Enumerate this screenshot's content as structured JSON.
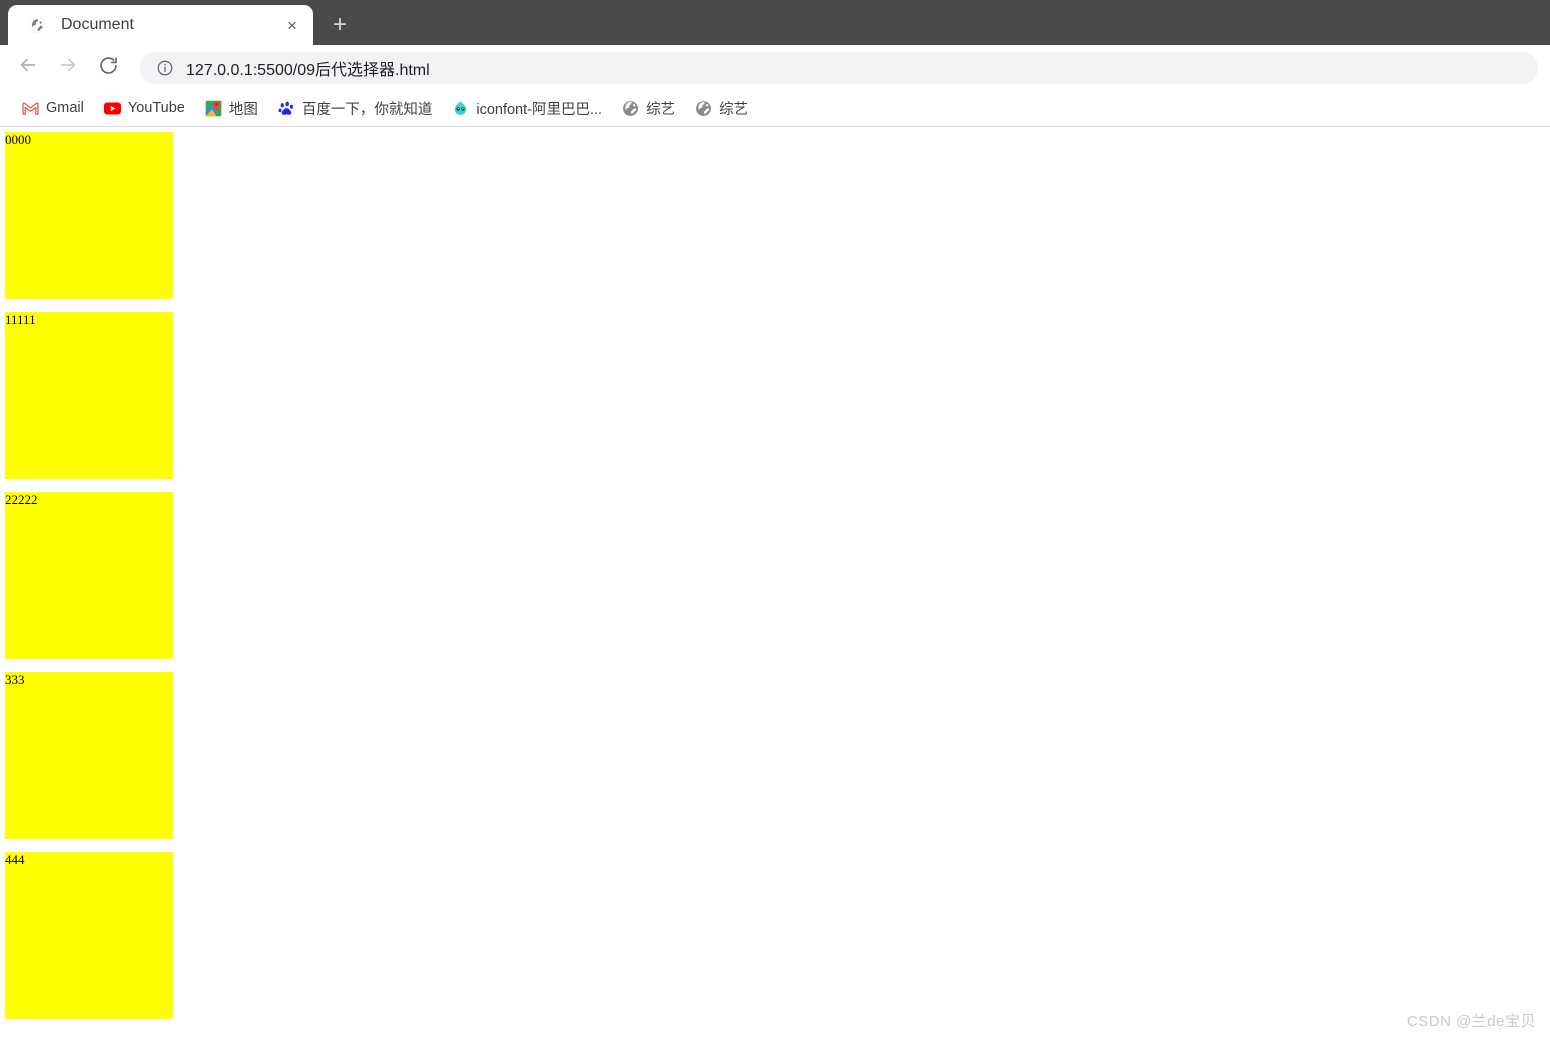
{
  "browser": {
    "tab": {
      "title": "Document",
      "favicon": "globe-icon",
      "close_label": "×"
    },
    "new_tab_label": "+",
    "nav": {
      "back_label": "←",
      "forward_label": "→",
      "reload_label": "↻"
    },
    "omnibox": {
      "security_icon": "info-circle-icon",
      "url": "127.0.0.1:5500/09后代选择器.html",
      "host": "127.0.0.1:5500",
      "path": "/09后代选择器.html"
    },
    "bookmarks": [
      {
        "label": "Gmail",
        "icon": "gmail-icon"
      },
      {
        "label": "YouTube",
        "icon": "youtube-icon"
      },
      {
        "label": "地图",
        "icon": "google-maps-icon"
      },
      {
        "label": "百度一下，你就知道",
        "icon": "baidu-icon"
      },
      {
        "label": "iconfont-阿里巴巴...",
        "icon": "iconfont-icon"
      },
      {
        "label": "综艺",
        "icon": "globe-icon"
      },
      {
        "label": "综艺",
        "icon": "globe-icon"
      }
    ]
  },
  "page": {
    "background_color": "#ffffff",
    "box_color": "#ffff00",
    "boxes": [
      {
        "text": "0000"
      },
      {
        "text": "11111"
      },
      {
        "text": "22222"
      },
      {
        "text": "333"
      },
      {
        "text": "444"
      }
    ]
  },
  "watermark": {
    "text": "CSDN @兰de宝贝"
  }
}
